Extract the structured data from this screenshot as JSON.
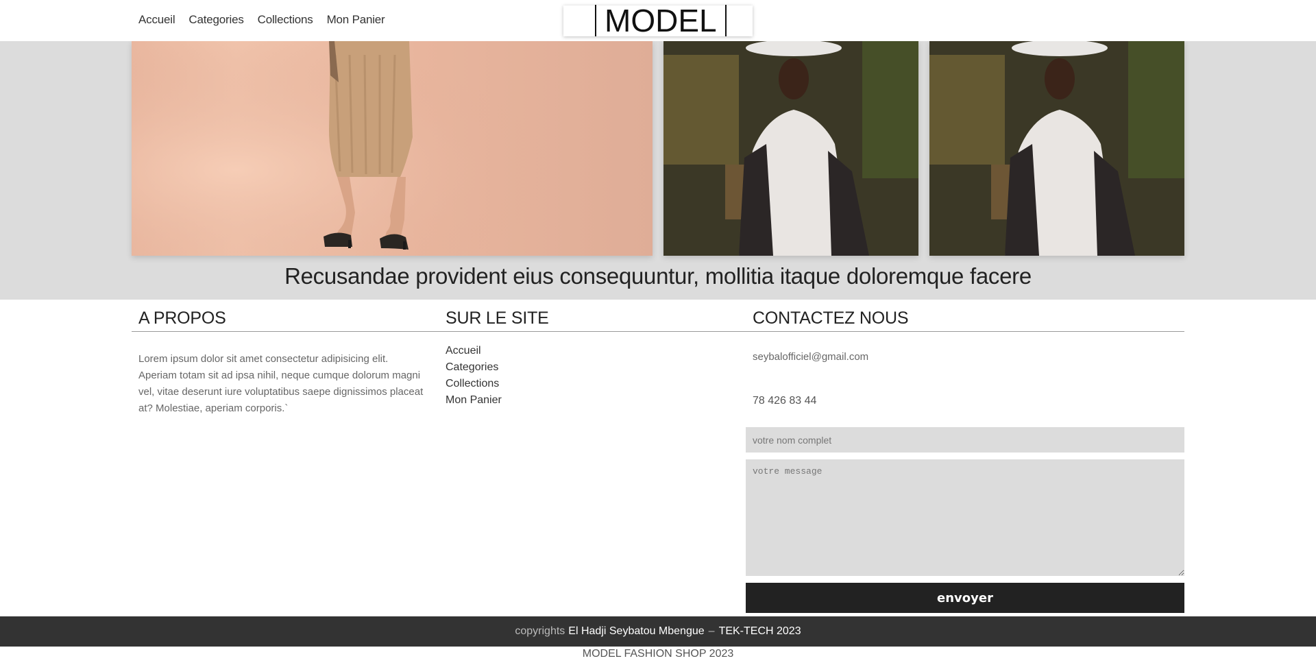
{
  "nav": {
    "items": [
      "Accueil",
      "Categories",
      "Collections",
      "Mon Panier"
    ]
  },
  "logo": {
    "text": "MODEL"
  },
  "hero": {
    "caption": "Recusandae provident eius consequuntur, mollitia itaque doloremque facere"
  },
  "footer": {
    "about": {
      "title": "A PROPOS",
      "text": "Lorem ipsum dolor sit amet consectetur adipisicing elit. Aperiam totam sit ad ipsa nihil, neque cumque dolorum magni vel, vitae deserunt iure voluptatibus saepe dignissimos placeat at? Molestiae, aperiam corporis.`"
    },
    "site": {
      "title": "SUR LE SITE",
      "links": [
        "Accueil",
        "Categories",
        "Collections",
        "Mon Panier"
      ]
    },
    "contact": {
      "title": "CONTACTEZ NOUS",
      "email": "seybalofficiel@gmail.com",
      "phone": "78 426 83 44",
      "name_placeholder": "votre nom complet",
      "message_placeholder": "votre message",
      "send_label": "envoyer"
    },
    "copyright": {
      "prefix": "copyrights",
      "author": "El Hadji Seybatou Mbengue",
      "separator": "–",
      "company": "TEK-TECH 2023"
    },
    "shop_line": "MODEL FASHION SHOP 2023"
  },
  "colors": {
    "hero_background": "#dcdcdc",
    "footer_bar": "#333333",
    "button": "#222222"
  }
}
